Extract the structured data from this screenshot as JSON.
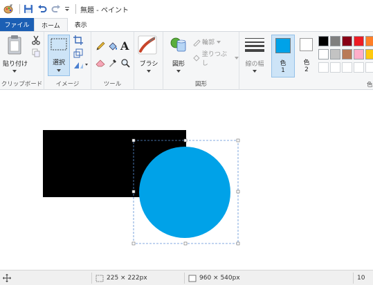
{
  "window": {
    "title": "無題 - ペイント"
  },
  "tabs": [
    {
      "label": "ファイル"
    },
    {
      "label": "ホーム"
    },
    {
      "label": "表示"
    }
  ],
  "ribbon": {
    "clipboard": {
      "paste_label": "貼り付け",
      "group_label": "クリップボード"
    },
    "image": {
      "select_label": "選択",
      "group_label": "イメージ"
    },
    "tools": {
      "group_label": "ツール"
    },
    "brush": {
      "label": "ブラシ"
    },
    "shapes": {
      "label": "図形",
      "outline_label": "輪郭",
      "fill_label": "塗りつぶし",
      "group_label": "図形"
    },
    "size": {
      "label": "線の幅"
    },
    "color1": {
      "label": "色",
      "num": "1",
      "value": "#00a2e8"
    },
    "color2": {
      "label": "色",
      "num": "2",
      "value": "#ffffff"
    },
    "colors_group_label": "色",
    "palette_row1": [
      "#000000",
      "#7f7f7f",
      "#880015",
      "#ed1c24",
      "#ff7f27"
    ],
    "palette_row2": [
      "#ffffff",
      "#c3c3c3",
      "#b97a57",
      "#ffaec9",
      "#ffc90e"
    ],
    "palette_row3": [
      "#ffffff",
      "#ffffff",
      "#ffffff",
      "#ffffff",
      "#ffffff"
    ]
  },
  "canvas": {
    "rect_color": "#000000",
    "circle_color": "#00a2e8"
  },
  "status": {
    "selection_size": "225 × 222px",
    "image_size": "960 × 540px",
    "zoom": "10"
  }
}
